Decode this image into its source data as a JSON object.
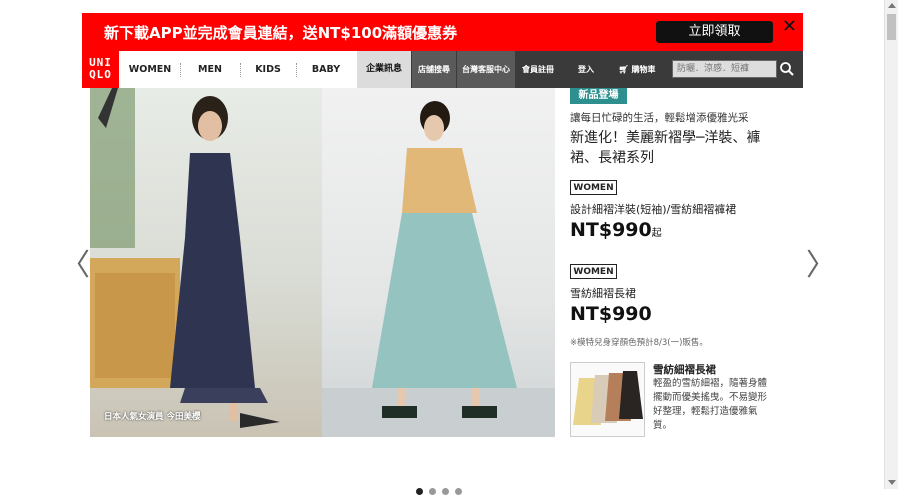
{
  "promo": {
    "text": "新下載APP並完成會員連結，送NT$100滿額優惠券",
    "button": "立即領取",
    "close": "✕"
  },
  "logo": {
    "line1": "UNI",
    "line2": "QLO"
  },
  "nav": {
    "categories": [
      "WOMEN",
      "MEN",
      "KIDS",
      "BABY"
    ],
    "corporate": "企業訊息",
    "links": [
      "店舖搜尋",
      "台灣客服中心",
      "會員註冊",
      "登入",
      "購物車"
    ],
    "search_placeholder": "防曬．涼感．短褲"
  },
  "hero": {
    "caption": "日本人氣女演員 今田美櫻"
  },
  "product": {
    "badge": "新品登場",
    "subtitle": "讓每日忙碌的生活，輕鬆增添優雅光采",
    "headline": "新進化！美麗新褶學─洋裝、褲裙、長裙系列",
    "items": [
      {
        "tag": "WOMEN",
        "name": "設計細褶洋裝(短袖)/雪紡細褶褲裙",
        "price": "NT$990",
        "suffix": "起"
      },
      {
        "tag": "WOMEN",
        "name": "雪紡細褶長裙",
        "price": "NT$990",
        "suffix": ""
      }
    ],
    "note": "※模特兒身穿顏色預計8/3(一)販售。",
    "thumb_name": "雪紡細褶長裙",
    "thumb_desc": "輕盈的雪紡細褶，隨著身體擺動而優美搖曳。不易變形好整理，輕鬆打造優雅氣質。"
  },
  "carousel": {
    "prev": "〈",
    "next": "〉",
    "active_index": 0,
    "count": 4
  },
  "colors": {
    "brand_red": "#ff0000",
    "accent_teal": "#2e8f8f",
    "nav_dark": "#3a3a3a"
  }
}
